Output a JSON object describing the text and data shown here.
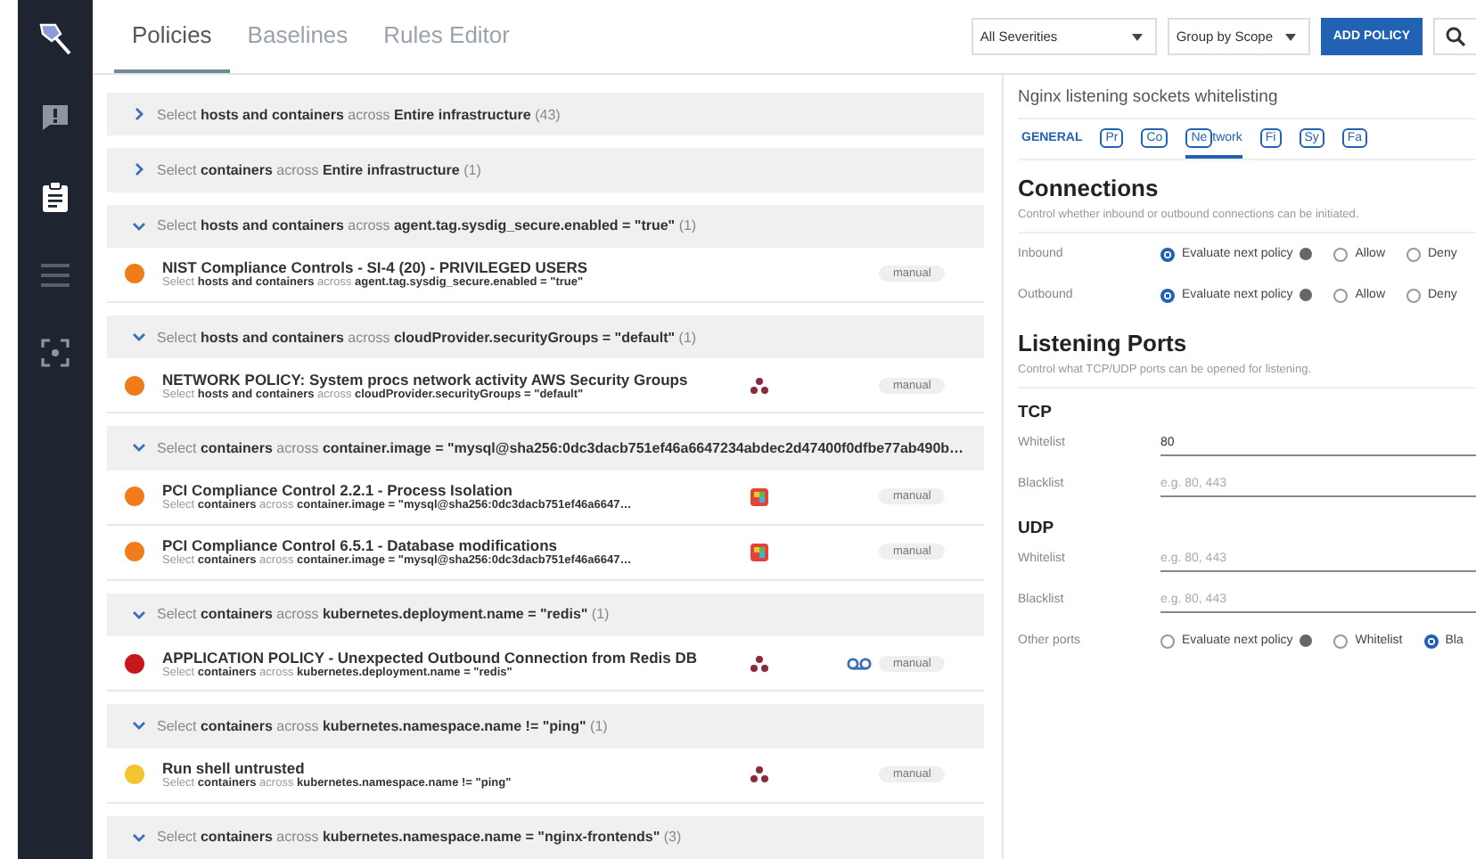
{
  "sidebar": {
    "items": [
      {
        "kind": "logo"
      },
      {
        "kind": "alert"
      },
      {
        "kind": "clipboard"
      },
      {
        "kind": "list"
      },
      {
        "kind": "capture"
      }
    ]
  },
  "tabs": [
    {
      "label": "Policies",
      "selected": true
    },
    {
      "label": "Baselines",
      "selected": false
    },
    {
      "label": "Rules Editor",
      "selected": false
    }
  ],
  "toolbar": {
    "severity": "All Severities",
    "grouping": "Group by Scope",
    "add_button": "ADD POLICY"
  },
  "groups": [
    {
      "title": "Select **hosts and containers** across **Entire infrastructure** (43)",
      "expanded": false
    },
    {
      "title": "Select **containers** across **Entire infrastructure** (1)",
      "expanded": false
    },
    {
      "title": "Select **hosts and containers** across **agent.tag.sysdig_secure.enabled = \"true\"** (1)",
      "expanded": true,
      "policies": [
        {
          "name": "NIST Compliance Controls - SI-4 (20) - PRIVILEGED USERS",
          "scope": "Select **hosts and containers** across **agent.tag.sysdig_secure.enabled = \"true\"**",
          "color": "#f07d1a",
          "kind": "plain",
          "recording": false,
          "tag": "manual"
        }
      ]
    },
    {
      "title": "Select **hosts and containers** across **cloudProvider.securityGroups = \"default\"** (1)",
      "expanded": true,
      "policies": [
        {
          "name": "NETWORK POLICY: System procs network activity AWS Security Groups",
          "scope": "Select **hosts and containers** across **cloudProvider.securityGroups = \"default\"**",
          "color": "#f07d1a",
          "kind": "nodes",
          "recording": false,
          "tag": "manual"
        }
      ]
    },
    {
      "title": "Select **containers** across **container.image = \"mysql@sha256:0dc3dacb751ef46a6647234abdec2d47400f0dfbe77ab490b…**",
      "expanded": true,
      "policies": [
        {
          "name": "PCI Compliance Control 2.2.1 - Process Isolation",
          "scope": "Select **containers** across **container.image = \"mysql@sha256:0dc3dacb751ef46a6647…**",
          "color": "#f07d1a",
          "kind": "app",
          "recording": false,
          "tag": "manual"
        },
        {
          "name": "PCI Compliance Control 6.5.1 - Database modifications",
          "scope": "Select **containers** across **container.image = \"mysql@sha256:0dc3dacb751ef46a6647…**",
          "color": "#f07d1a",
          "kind": "app",
          "recording": false,
          "tag": "manual"
        }
      ]
    },
    {
      "title": "Select **containers** across **kubernetes.deployment.name = \"redis\"** (1)",
      "expanded": true,
      "policies": [
        {
          "name": "APPLICATION POLICY - Unexpected Outbound Connection from Redis DB",
          "scope": "Select **containers** across **kubernetes.deployment.name = \"redis\"**",
          "color": "#c8161d",
          "kind": "nodes",
          "recording": true,
          "tag": "manual"
        }
      ]
    },
    {
      "title": "Select **containers** across **kubernetes.namespace.name != \"ping\"** (1)",
      "expanded": true,
      "policies": [
        {
          "name": "Run shell untrusted",
          "scope": "Select **containers** across **kubernetes.namespace.name != \"ping\"**",
          "color": "#f5c431",
          "kind": "nodes",
          "recording": false,
          "tag": "manual"
        }
      ]
    },
    {
      "title": "Select **containers** across **kubernetes.namespace.name = \"nginx-frontends\"** (3)",
      "expanded": true
    }
  ],
  "panel": {
    "title": "Nginx listening sockets whitelisting",
    "tabs": [
      {
        "label": "GENERAL",
        "kind": "text",
        "selected": false
      },
      {
        "label": "Pr",
        "kind": "box",
        "selected": false
      },
      {
        "label": "Co",
        "kind": "box",
        "selected": false
      },
      {
        "label": "Ne",
        "rest": "twork",
        "kind": "box",
        "selected": true
      },
      {
        "label": "Fi",
        "kind": "box",
        "selected": false
      },
      {
        "label": "Sy",
        "kind": "box",
        "selected": false
      },
      {
        "label": "Fa",
        "kind": "box",
        "selected": false
      }
    ],
    "sections": [
      {
        "heading": "Connections",
        "description": "Control whether inbound or outbound connections can be initiated.",
        "rows": [
          {
            "kind": "radios",
            "label": "Inbound",
            "options": [
              {
                "label": "Evaluate next policy",
                "help": true,
                "selected": true
              },
              {
                "label": "Allow",
                "help": false,
                "selected": false
              },
              {
                "label": "Deny",
                "help": false,
                "selected": false
              }
            ]
          },
          {
            "kind": "radios",
            "label": "Outbound",
            "options": [
              {
                "label": "Evaluate next policy",
                "help": true,
                "selected": true
              },
              {
                "label": "Allow",
                "help": false,
                "selected": false
              },
              {
                "label": "Deny",
                "help": false,
                "selected": false
              }
            ]
          }
        ]
      },
      {
        "heading": "Listening Ports",
        "description": "Control what TCP/UDP ports can be opened for listening.",
        "rows": [
          {
            "kind": "subheading",
            "label": "TCP"
          },
          {
            "kind": "field",
            "label": "Whitelist",
            "value": "80"
          },
          {
            "kind": "field",
            "label": "Blacklist",
            "placeholder": "e.g. 80, 443"
          },
          {
            "kind": "subheading",
            "label": "UDP"
          },
          {
            "kind": "field",
            "label": "Whitelist",
            "placeholder": "e.g. 80, 443"
          },
          {
            "kind": "field",
            "label": "Blacklist",
            "placeholder": "e.g. 80, 443"
          },
          {
            "kind": "radios",
            "label": "Other ports",
            "options": [
              {
                "label": "Evaluate next policy",
                "help": true,
                "selected": false
              },
              {
                "label": "Whitelist",
                "help": false,
                "selected": false
              },
              {
                "label": "Bla",
                "help": false,
                "selected": true
              }
            ]
          }
        ]
      }
    ]
  }
}
